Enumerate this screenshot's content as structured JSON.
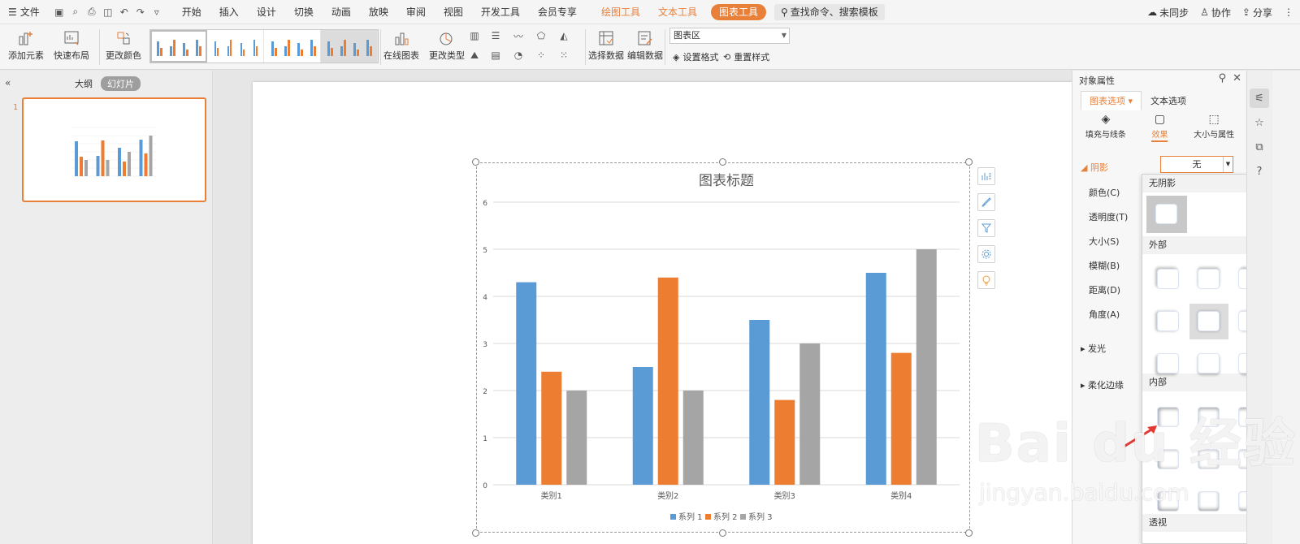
{
  "menubar": {
    "file_label": "文件",
    "tabs": [
      "开始",
      "插入",
      "设计",
      "切换",
      "动画",
      "放映",
      "审阅",
      "视图",
      "开发工具",
      "会员专享"
    ],
    "tool_tabs": [
      "绘图工具",
      "文本工具"
    ],
    "active_tool_tab": "图表工具",
    "search_placeholder": "查找命令、搜索模板",
    "right": {
      "unsync": "未同步",
      "collab": "协作",
      "share": "分享"
    }
  },
  "ribbon": {
    "add_element": "添加元素",
    "quick_layout": "快速布局",
    "change_color": "更改颜色",
    "online_chart": "在线图表",
    "change_type": "更改类型",
    "select_data": "选择数据",
    "edit_data": "编辑数据",
    "chart_area_combo": "图表区",
    "set_format": "设置格式",
    "reset_style": "重置样式"
  },
  "left_panel": {
    "outline_tab": "大纲",
    "slides_tab": "幻灯片",
    "slide_number": "1"
  },
  "right_pane": {
    "title": "对象属性",
    "tab_chart_options": "图表选项",
    "tab_text_options": "文本选项",
    "sub_fill_line": "填充与线条",
    "sub_effects": "效果",
    "sub_size_props": "大小与属性",
    "shadow_section": "阴影",
    "shadow_value": "无",
    "rows": [
      "颜色(C)",
      "透明度(T)",
      "大小(S)",
      "模糊(B)",
      "距离(D)",
      "角度(A)"
    ],
    "glow_section": "发光",
    "soft_edges_section": "柔化边缘"
  },
  "shadow_popup": {
    "no_shadow": "无阴影",
    "outer": "外部",
    "inner": "内部",
    "perspective": "透视"
  },
  "watermark": {
    "brand": "Bai du 经验",
    "url": "jingyan.baidu.com"
  },
  "colors": {
    "accent": "#e8803a",
    "series1": "#5b9bd5",
    "series2": "#ed7d31",
    "series3": "#a5a5a5"
  },
  "chart_data": {
    "type": "bar",
    "title": "图表标题",
    "categories": [
      "类别1",
      "类别2",
      "类别3",
      "类别4"
    ],
    "series": [
      {
        "name": "系列 1",
        "values": [
          4.3,
          2.5,
          3.5,
          4.5
        ]
      },
      {
        "name": "系列 2",
        "values": [
          2.4,
          4.4,
          1.8,
          2.8
        ]
      },
      {
        "name": "系列 3",
        "values": [
          2,
          2,
          3,
          5
        ]
      }
    ],
    "ylim": [
      0,
      6
    ],
    "yticks": [
      0,
      1,
      2,
      3,
      4,
      5,
      6
    ],
    "grid": true,
    "legend": "bottom"
  }
}
